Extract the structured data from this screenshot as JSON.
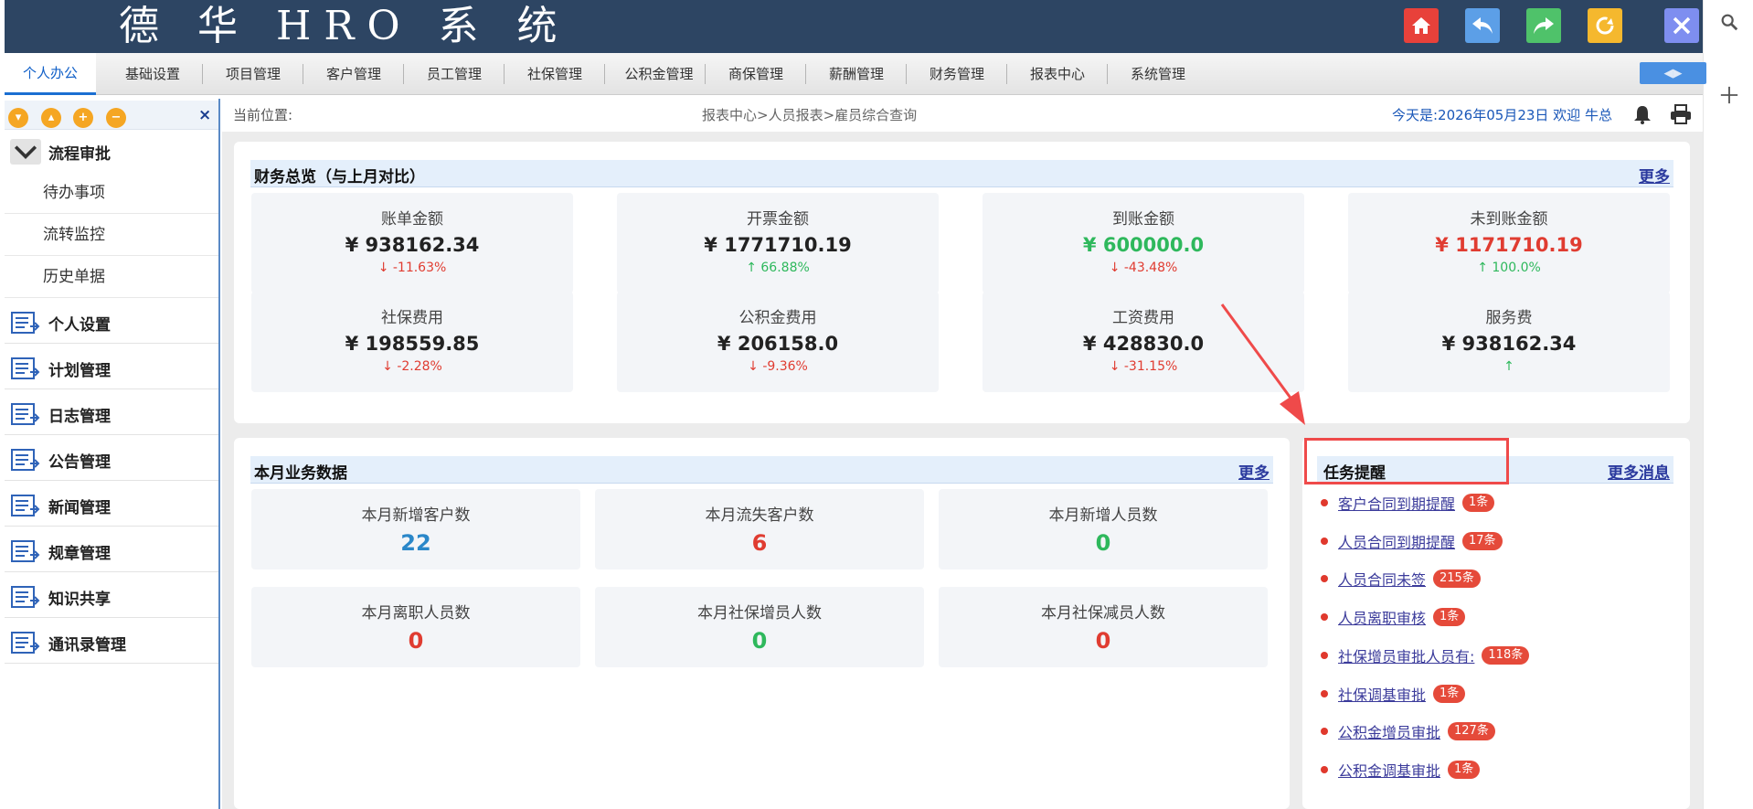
{
  "app": {
    "title": "德 华 HRO 系 统"
  },
  "header_buttons": [
    {
      "name": "home-icon",
      "color": "#e8413a"
    },
    {
      "name": "back-icon",
      "color": "#5c9fe7"
    },
    {
      "name": "forward-icon",
      "color": "#4fc26a"
    },
    {
      "name": "refresh-icon",
      "color": "#f5b82e"
    },
    {
      "name": "close-icon",
      "color": "#7e8ef0"
    }
  ],
  "nav": {
    "items": [
      "个人办公",
      "基础设置",
      "项目管理",
      "客户管理",
      "员工管理",
      "社保管理",
      "公积金管理",
      "商保管理",
      "薪酬管理",
      "财务管理",
      "报表中心",
      "系统管理"
    ],
    "active_index": 0
  },
  "sidebar": {
    "expanded_group": "流程审批",
    "sub_items": [
      "待办事项",
      "流转监控",
      "历史单据"
    ],
    "groups": [
      "个人设置",
      "计划管理",
      "日志管理",
      "公告管理",
      "新闻管理",
      "规章管理",
      "知识共享",
      "通讯录管理"
    ]
  },
  "breadcrumb": {
    "label": "当前位置:",
    "path": "报表中心>人员报表>雇员综合查询",
    "date_greeting": "今天是:2026年05月23日 欢迎 牛总"
  },
  "finance": {
    "title": "财务总览（与上月对比）",
    "more": "更多",
    "items": [
      {
        "label": "账单金额",
        "value": "¥ 938162.34",
        "change": "↓ -11.63%",
        "value_color": "default",
        "change_color": "red"
      },
      {
        "label": "开票金额",
        "value": "¥ 1771710.19",
        "change": "↑ 66.88%",
        "value_color": "default",
        "change_color": "green"
      },
      {
        "label": "到账金额",
        "value": "¥ 600000.0",
        "change": "↓ -43.48%",
        "value_color": "green",
        "change_color": "red"
      },
      {
        "label": "未到账金额",
        "value": "¥ 1171710.19",
        "change": "↑ 100.0%",
        "value_color": "red",
        "change_color": "green"
      },
      {
        "label": "社保费用",
        "value": "¥ 198559.85",
        "change": "↓ -2.28%",
        "value_color": "default",
        "change_color": "red"
      },
      {
        "label": "公积金费用",
        "value": "¥ 206158.0",
        "change": "↓ -9.36%",
        "value_color": "default",
        "change_color": "red"
      },
      {
        "label": "工资费用",
        "value": "¥ 428830.0",
        "change": "↓ -31.15%",
        "value_color": "default",
        "change_color": "red"
      },
      {
        "label": "服务费",
        "value": "¥ 938162.34",
        "change": "↑",
        "value_color": "default",
        "change_color": "green"
      }
    ]
  },
  "business": {
    "title": "本月业务数据",
    "more": "更多",
    "items": [
      {
        "label": "本月新增客户数",
        "value": "22",
        "color": "blue"
      },
      {
        "label": "本月流失客户数",
        "value": "6",
        "color": "red"
      },
      {
        "label": "本月新增人员数",
        "value": "0",
        "color": "green"
      },
      {
        "label": "本月离职人员数",
        "value": "0",
        "color": "red"
      },
      {
        "label": "本月社保增员人数",
        "value": "0",
        "color": "green"
      },
      {
        "label": "本月社保减员人数",
        "value": "0",
        "color": "red"
      }
    ]
  },
  "tasks": {
    "title": "任务提醒",
    "more": "更多消息",
    "items": [
      {
        "label": "客户合同到期提醒",
        "badge": "1条"
      },
      {
        "label": "人员合同到期提醒",
        "badge": "17条"
      },
      {
        "label": "人员合同未签",
        "badge": "215条"
      },
      {
        "label": "人员离职审核",
        "badge": "1条"
      },
      {
        "label": "社保增员审批人员有:",
        "badge": "118条"
      },
      {
        "label": "社保调基审批",
        "badge": "1条"
      },
      {
        "label": "公积金增员审批",
        "badge": "127条"
      },
      {
        "label": "公积金调基审批",
        "badge": "1条"
      }
    ]
  },
  "annotation": {
    "color": "#ef4a4a"
  }
}
